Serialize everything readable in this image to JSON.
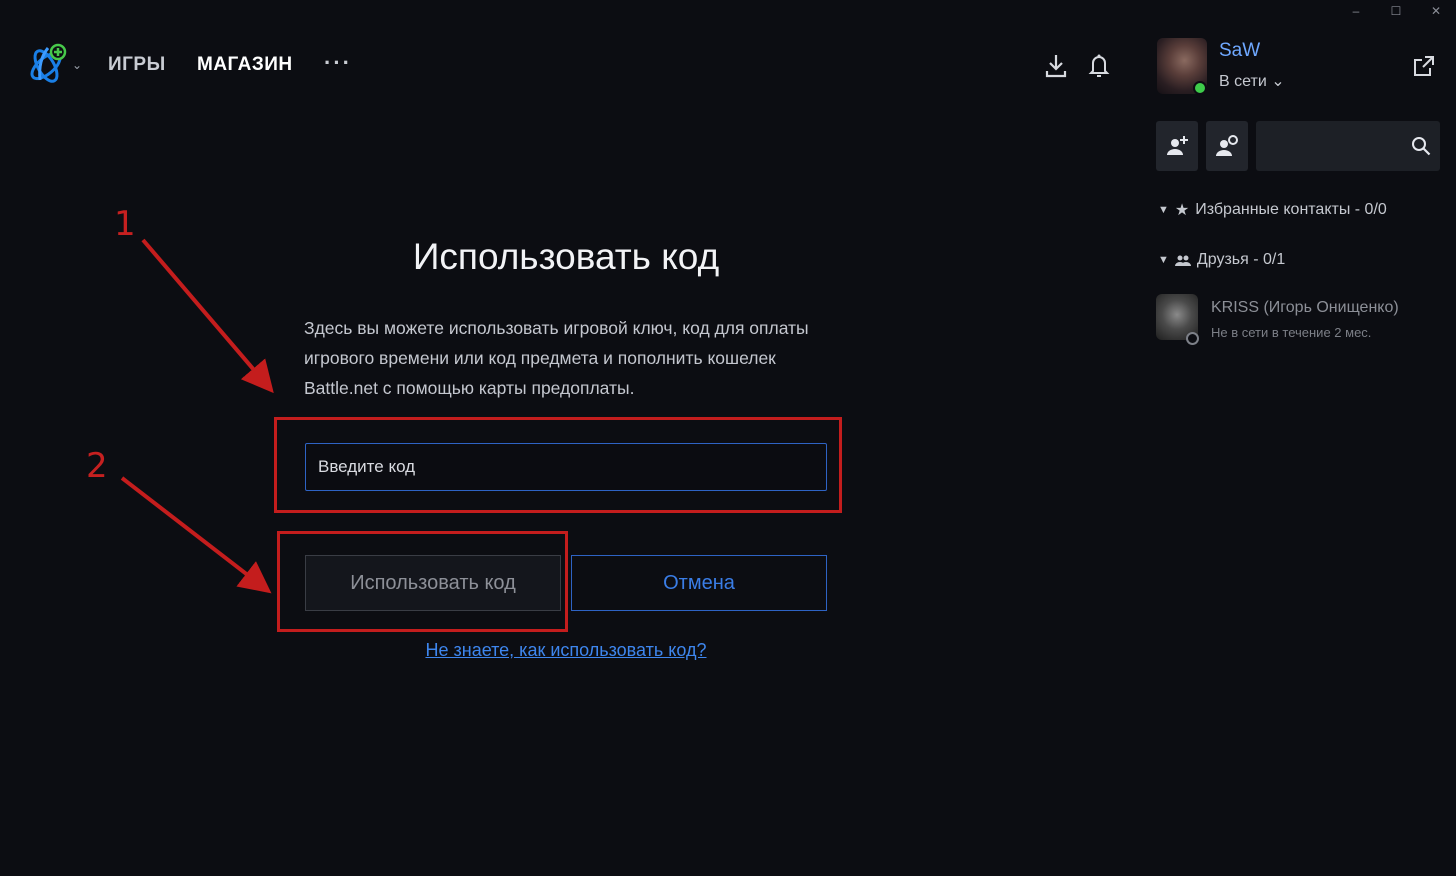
{
  "window": {
    "minimize": "–",
    "maximize": "☐",
    "close": "✕"
  },
  "nav": {
    "games": "ИГРЫ",
    "shop": "МАГАЗИН",
    "more": "···"
  },
  "main": {
    "title": "Использовать код",
    "description": "Здесь вы можете использовать игровой ключ, код для оплаты игрового времени или код предмета и пополнить кошелек Battle.net с помощью карты предоплаты.",
    "input_placeholder": "Введите код",
    "redeem_button": "Использовать код",
    "cancel_button": "Отмена",
    "help_link": "Не знаете, как использовать код?"
  },
  "annotations": {
    "one": "1",
    "two": "2"
  },
  "profile": {
    "name": "SaW",
    "status": "В сети ⌄"
  },
  "social": {
    "favorites_header": "Избранные контакты - 0/0",
    "friends_header": "Друзья - 0/1",
    "friends": [
      {
        "name": "KRISS (Игорь Онищенко)",
        "status": "Не в сети в течение 2 мес."
      }
    ]
  },
  "colors": {
    "accent_blue": "#2e63c4",
    "link_blue": "#3e86ee",
    "annotation_red": "#c41d1d",
    "online_green": "#3ecc4a",
    "background": "#0c0d12"
  },
  "icons": [
    "battlenet-logo-icon",
    "download-icon",
    "bell-icon",
    "external-link-icon",
    "add-friend-icon",
    "friend-requests-icon",
    "search-icon",
    "star-icon",
    "friends-icon"
  ]
}
